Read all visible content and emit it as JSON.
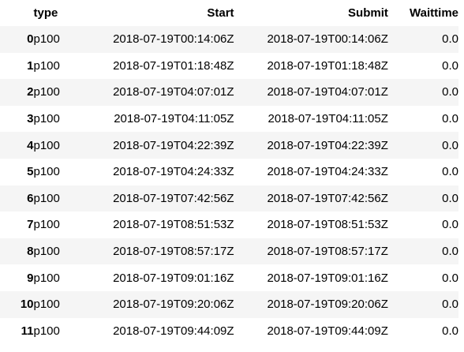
{
  "table": {
    "columns": {
      "index": "",
      "type": "type",
      "start": "Start",
      "submit": "Submit",
      "waittime": "Waittime"
    },
    "rows": [
      {
        "index": "0",
        "type": "p100",
        "start": "2018-07-19T00:14:06Z",
        "submit": "2018-07-19T00:14:06Z",
        "waittime": "0.0"
      },
      {
        "index": "1",
        "type": "p100",
        "start": "2018-07-19T01:18:48Z",
        "submit": "2018-07-19T01:18:48Z",
        "waittime": "0.0"
      },
      {
        "index": "2",
        "type": "p100",
        "start": "2018-07-19T04:07:01Z",
        "submit": "2018-07-19T04:07:01Z",
        "waittime": "0.0"
      },
      {
        "index": "3",
        "type": "p100",
        "start": "2018-07-19T04:11:05Z",
        "submit": "2018-07-19T04:11:05Z",
        "waittime": "0.0"
      },
      {
        "index": "4",
        "type": "p100",
        "start": "2018-07-19T04:22:39Z",
        "submit": "2018-07-19T04:22:39Z",
        "waittime": "0.0"
      },
      {
        "index": "5",
        "type": "p100",
        "start": "2018-07-19T04:24:33Z",
        "submit": "2018-07-19T04:24:33Z",
        "waittime": "0.0"
      },
      {
        "index": "6",
        "type": "p100",
        "start": "2018-07-19T07:42:56Z",
        "submit": "2018-07-19T07:42:56Z",
        "waittime": "0.0"
      },
      {
        "index": "7",
        "type": "p100",
        "start": "2018-07-19T08:51:53Z",
        "submit": "2018-07-19T08:51:53Z",
        "waittime": "0.0"
      },
      {
        "index": "8",
        "type": "p100",
        "start": "2018-07-19T08:57:17Z",
        "submit": "2018-07-19T08:57:17Z",
        "waittime": "0.0"
      },
      {
        "index": "9",
        "type": "p100",
        "start": "2018-07-19T09:01:16Z",
        "submit": "2018-07-19T09:01:16Z",
        "waittime": "0.0"
      },
      {
        "index": "10",
        "type": "p100",
        "start": "2018-07-19T09:20:06Z",
        "submit": "2018-07-19T09:20:06Z",
        "waittime": "0.0"
      },
      {
        "index": "11",
        "type": "p100",
        "start": "2018-07-19T09:44:09Z",
        "submit": "2018-07-19T09:44:09Z",
        "waittime": "0.0"
      }
    ]
  },
  "colors": {
    "stripe": "#f5f5f5",
    "text": "#000000",
    "background": "#ffffff"
  }
}
